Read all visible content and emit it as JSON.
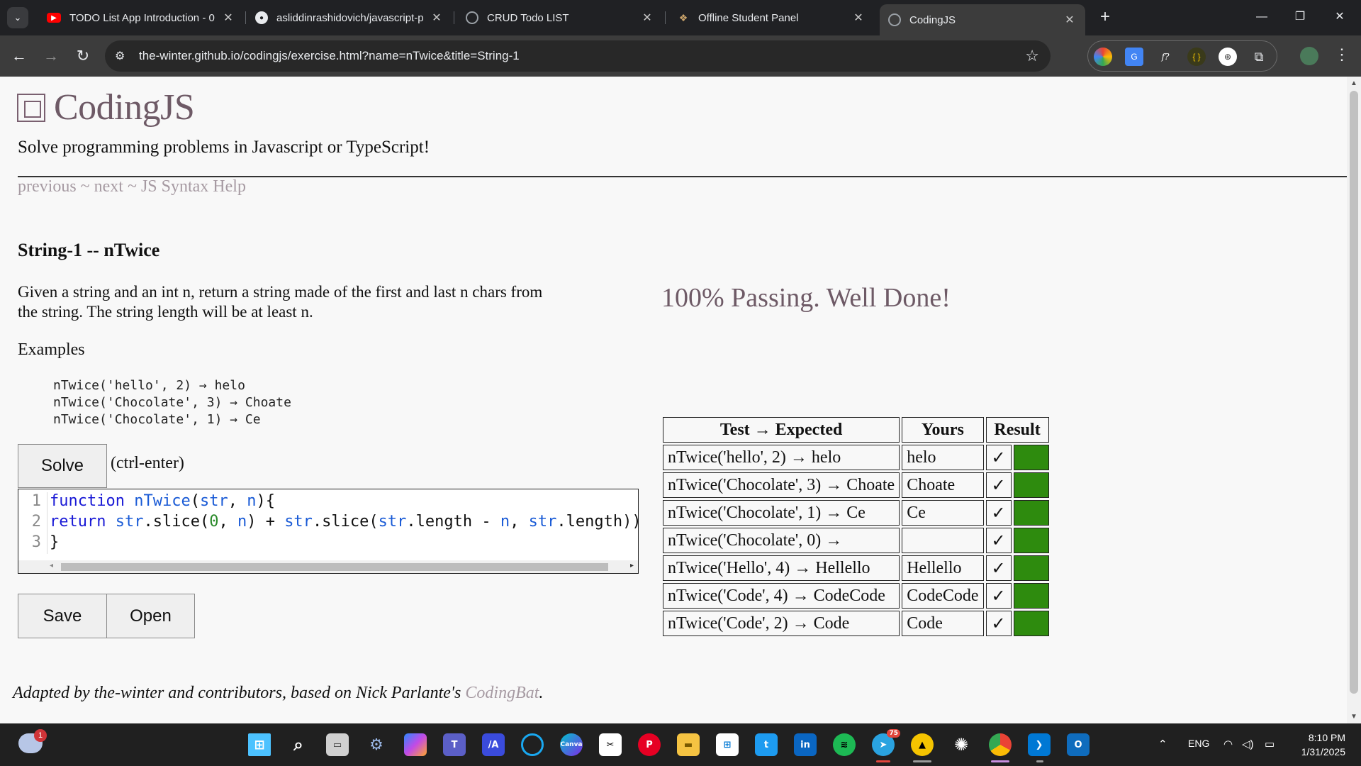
{
  "browser": {
    "tabs": [
      {
        "title": "TODO List App Introduction - 0",
        "favicon": "youtube-icon",
        "color": "#ff0000"
      },
      {
        "title": "asliddinrashidovich/javascript-p",
        "favicon": "github-icon",
        "color": "#e8eaed"
      },
      {
        "title": "CRUD Todo LIST",
        "favicon": "globe-icon",
        "color": "#9aa0a6"
      },
      {
        "title": "Offline Student Panel",
        "favicon": "site-icon",
        "color": "#8a6d3b"
      },
      {
        "title": "CodingJS",
        "favicon": "globe-icon",
        "color": "#9aa0a6",
        "active": true
      }
    ],
    "url": "the-winter.github.io/codingjs/exercise.html?name=nTwice&title=String-1",
    "new_tab": "+",
    "controls": {
      "minimize": "—",
      "restore": "❐",
      "close": "✕"
    }
  },
  "page": {
    "logo": "CodingJS",
    "subtitle": "Solve programming problems in Javascript or TypeScript!",
    "nav": {
      "previous": "previous",
      "sep1": " ~ ",
      "next": "next",
      "sep2": " ~ ",
      "help": "JS Syntax Help"
    },
    "problem": {
      "title": "String-1 -- nTwice",
      "description": "Given a string and an int n, return a string made of the first and last n chars from the string. The string length will be at least n.",
      "examples_label": "Examples",
      "examples": [
        "nTwice('hello', 2) → helo",
        "nTwice('Chocolate', 3) → Choate",
        "nTwice('Chocolate', 1) → Ce"
      ]
    },
    "solve_button": "Solve",
    "solve_hint": "(ctrl-enter)",
    "editor": {
      "line_numbers": [
        "1",
        "2",
        "3"
      ],
      "line1": {
        "kw": "function",
        "fn": "nTwice",
        "p1": "(",
        "a1": "str",
        "p2": ", ",
        "a2": "n",
        "p3": "){"
      },
      "line2": {
        "kw": "return",
        "v1": "str",
        "t1": ".slice(",
        "n1": "0",
        "t2": ", ",
        "v2": "n",
        "t3": ") + ",
        "v3": "str",
        "t4": ".slice(",
        "v4": "str",
        "t5": ".length - ",
        "v5": "n",
        "t6": ", ",
        "v6": "str",
        "t7": ".length));"
      },
      "line3": "}"
    },
    "save_button": "Save",
    "open_button": "Open",
    "passing_message": "100% Passing. Well Done!",
    "results": {
      "headers": [
        "Test → Expected",
        "Yours",
        "Result"
      ],
      "rows": [
        {
          "test": "nTwice('hello', 2) → helo",
          "yours": "helo",
          "result": "✓"
        },
        {
          "test": "nTwice('Chocolate', 3) → Choate",
          "yours": "Choate",
          "result": "✓"
        },
        {
          "test": "nTwice('Chocolate', 1) → Ce",
          "yours": "Ce",
          "result": "✓"
        },
        {
          "test": "nTwice('Chocolate', 0) →",
          "yours": "",
          "result": "✓"
        },
        {
          "test": "nTwice('Hello', 4) → Hellello",
          "yours": "Hellello",
          "result": "✓"
        },
        {
          "test": "nTwice('Code', 4) → CodeCode",
          "yours": "CodeCode",
          "result": "✓"
        },
        {
          "test": "nTwice('Code', 2) → Code",
          "yours": "Code",
          "result": "✓"
        }
      ],
      "pass_color": "#2e8b0e"
    },
    "footer": {
      "text": "Adapted by the-winter and contributors, based on Nick Parlante's ",
      "link": "CodingBat",
      "end": "."
    }
  },
  "taskbar": {
    "weather_badge": "1",
    "telegram_badge": "75",
    "tray": {
      "language": "ENG",
      "time": "8:10 PM",
      "date": "1/31/2025"
    }
  }
}
